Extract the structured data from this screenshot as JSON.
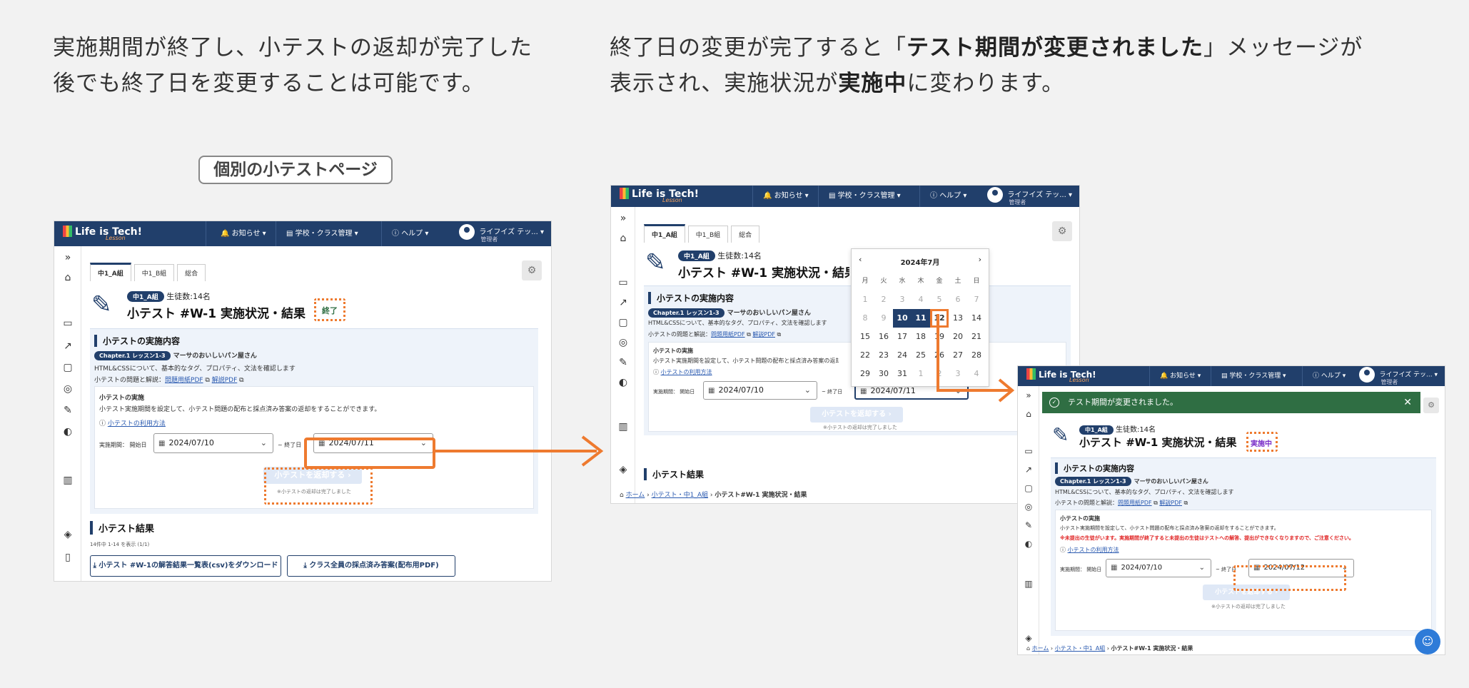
{
  "captions": {
    "left_line1": "実施期間が終了し、小テストの返却が完了した",
    "left_line2": "後でも終了日を変更することは可能です。",
    "right_line1_pre": "終了日の変更が完了すると「",
    "right_line1_bold": "テスト期間が変更されました",
    "right_line1_post": "」メッセージが",
    "right_line2_pre": "表示され、実施状況が",
    "right_line2_bold": "実施中",
    "right_line2_post": "に変わります。"
  },
  "page_label": "個別の小テストページ",
  "header": {
    "logo": "Life is Tech!",
    "logo_sub": "Lesson",
    "nav_notice": "お知らせ ▾",
    "nav_school": "学校・クラス管理 ▾",
    "nav_help": "ヘルプ ▾",
    "user_name": "ライフイズ テッ... ▾",
    "user_role": "管理者"
  },
  "tabs": [
    "中1_A組",
    "中1_B組",
    "総合"
  ],
  "test": {
    "class_pill": "中1_A組",
    "students": "生徒数:14名",
    "title": "小テスト #W-1 実施状況・結果",
    "status_done": "終了",
    "status_active": "実施中",
    "content_heading": "小テストの実施内容",
    "chapter": "Chapter.1 レッスン1-3",
    "lesson": "マーサのおいしいパン屋さん",
    "desc": "HTML&CSSについて、基本的なタグ、プロパティ、文法を確認します",
    "material_label": "小テストの問題と解説：",
    "pdf_question": "問題用紙PDF",
    "pdf_answer": "解説PDF",
    "exec_heading": "小テストの実施",
    "exec_desc": "小テスト実施期間を設定して、小テスト問題の配布と採点済み答案の返却をすることができます。",
    "usage_link": "小テストの利用方法",
    "period_label": "実施期間：",
    "start_label": "開始日",
    "end_label": "~ 終了日",
    "start_date": "2024/07/10",
    "end_date_before": "2024/07/11",
    "end_date_after": "2024/07/12",
    "return_button": "小テストを返却する ›",
    "return_note": "※小テストの返却は完了しました",
    "warning": "※未提出の生徒がいます。実施期間が終了すると未提出の生徒はテストへの解答、提出ができなくなりますので、ご注意ください。",
    "results_heading": "小テスト結果",
    "results_count": "14件中 1-14 を表示 (1/1)",
    "download_csv": "⤓ 小テスト #W-1の解答結果一覧表(csv)をダウンロード",
    "download_pdf": "⤓ クラス全員の採点済み答案(配布用PDF)"
  },
  "calendar": {
    "month": "2024年7月",
    "weekdays": [
      "月",
      "火",
      "水",
      "木",
      "金",
      "土",
      "日"
    ],
    "weeks": [
      [
        "1",
        "2",
        "3",
        "4",
        "5",
        "6",
        "7"
      ],
      [
        "8",
        "9",
        "10",
        "11",
        "12",
        "13",
        "14"
      ],
      [
        "15",
        "16",
        "17",
        "18",
        "19",
        "20",
        "21"
      ],
      [
        "22",
        "23",
        "24",
        "25",
        "26",
        "27",
        "28"
      ],
      [
        "29",
        "30",
        "31",
        "1",
        "2",
        "3",
        "4"
      ]
    ]
  },
  "toast": {
    "message": "テスト期間が変更されました。"
  },
  "breadcrumb": {
    "home": "ホーム",
    "list": "小テスト・中1_A組",
    "current": "小テスト#W-1 実施状況・結果"
  },
  "colors": {
    "header_bg": "#213f6b",
    "accent_orange": "#ee7a2f",
    "toast_green": "#2f6e43"
  }
}
